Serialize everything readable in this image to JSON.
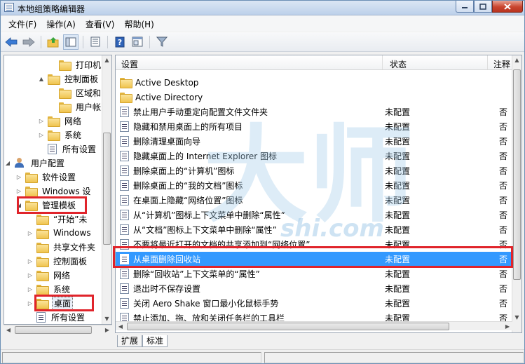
{
  "window": {
    "title": "本地组策略编辑器"
  },
  "menu": [
    "文件(F)",
    "操作(A)",
    "查看(V)",
    "帮助(H)"
  ],
  "toolbar": [
    "back-icon",
    "forward-icon",
    "up-folder-icon",
    "show-hide-tree-icon",
    "export-list-icon",
    "help-icon",
    "properties-icon",
    "filter-icon"
  ],
  "tree": [
    {
      "label": "打印机",
      "type": "folder",
      "level": 4,
      "expander": ""
    },
    {
      "label": "控制面板",
      "type": "folder",
      "level": 3,
      "expander": "▲"
    },
    {
      "label": "区域和",
      "type": "folder",
      "level": 4,
      "expander": ""
    },
    {
      "label": "用户帐",
      "type": "folder",
      "level": 4,
      "expander": ""
    },
    {
      "label": "网络",
      "type": "folder",
      "level": 3,
      "expander": "▷"
    },
    {
      "label": "系统",
      "type": "folder",
      "level": 3,
      "expander": "▷"
    },
    {
      "label": "所有设置",
      "type": "settings",
      "level": 3,
      "expander": ""
    },
    {
      "label": "用户配置",
      "type": "user",
      "level": 0,
      "expander": "◢"
    },
    {
      "label": "软件设置",
      "type": "folder",
      "level": 1,
      "expander": "▷"
    },
    {
      "label": "Windows 设",
      "type": "folder",
      "level": 1,
      "expander": "▷"
    },
    {
      "label": "管理模板",
      "type": "folder",
      "level": 1,
      "expander": "◢"
    },
    {
      "label": "“开始”未",
      "type": "folder",
      "level": 2,
      "expander": ""
    },
    {
      "label": "Windows",
      "type": "folder",
      "level": 2,
      "expander": "▷"
    },
    {
      "label": "共享文件夹",
      "type": "folder",
      "level": 2,
      "expander": ""
    },
    {
      "label": "控制面板",
      "type": "folder",
      "level": 2,
      "expander": "▷"
    },
    {
      "label": "网络",
      "type": "folder",
      "level": 2,
      "expander": "▷"
    },
    {
      "label": "系统",
      "type": "folder",
      "level": 2,
      "expander": "▷"
    },
    {
      "label": "桌面",
      "type": "folder",
      "level": 2,
      "expander": "▷",
      "selected": true
    },
    {
      "label": "所有设置",
      "type": "settings",
      "level": 2,
      "expander": ""
    }
  ],
  "list": {
    "headers": {
      "setting": "设置",
      "state": "状态",
      "note": "注释"
    },
    "rows": [
      {
        "name": "Active Desktop",
        "type": "folder",
        "state": "",
        "note": ""
      },
      {
        "name": "Active Directory",
        "type": "folder",
        "state": "",
        "note": ""
      },
      {
        "name": "禁止用户手动重定向配置文件文件夹",
        "type": "setting",
        "state": "未配置",
        "note": "否"
      },
      {
        "name": "隐藏和禁用桌面上的所有项目",
        "type": "setting",
        "state": "未配置",
        "note": "否"
      },
      {
        "name": "删除清理桌面向导",
        "type": "setting",
        "state": "未配置",
        "note": "否"
      },
      {
        "name": "隐藏桌面上的 Internet Explorer 图标",
        "type": "setting",
        "state": "未配置",
        "note": "否"
      },
      {
        "name": "删除桌面上的“计算机”图标",
        "type": "setting",
        "state": "未配置",
        "note": "否"
      },
      {
        "name": "删除桌面上的“我的文档”图标",
        "type": "setting",
        "state": "未配置",
        "note": "否"
      },
      {
        "name": "在桌面上隐藏“网络位置”图标",
        "type": "setting",
        "state": "未配置",
        "note": "否"
      },
      {
        "name": "从“计算机”图标上下文菜单中删除“属性”",
        "type": "setting",
        "state": "未配置",
        "note": "否"
      },
      {
        "name": "从“文档”图标上下文菜单中删除“属性”",
        "type": "setting",
        "state": "未配置",
        "note": "否"
      },
      {
        "name": "不要将最近打开的文档的共享添加到“网络位置”",
        "type": "setting",
        "state": "未配置",
        "note": "否"
      },
      {
        "name": "从桌面删除回收站",
        "type": "setting",
        "state": "未配置",
        "note": "否",
        "selected": true
      },
      {
        "name": "删除“回收站”上下文菜单的“属性”",
        "type": "setting",
        "state": "未配置",
        "note": "否"
      },
      {
        "name": "退出时不保存设置",
        "type": "setting",
        "state": "未配置",
        "note": "否"
      },
      {
        "name": "关闭 Aero Shake 窗口最小化鼠标手势",
        "type": "setting",
        "state": "未配置",
        "note": "否"
      },
      {
        "name": "禁止添加、拖、放和关闭任务栏的工具栏",
        "type": "setting",
        "state": "未配置",
        "note": "否"
      }
    ]
  },
  "tabs": [
    "扩展",
    "标准"
  ],
  "watermark": {
    "text": "大师",
    "subtext": "shi.com"
  },
  "colors": {
    "selection": "#3399ff",
    "highlight": "#e0242b",
    "watermark": "#9ec8e8"
  }
}
